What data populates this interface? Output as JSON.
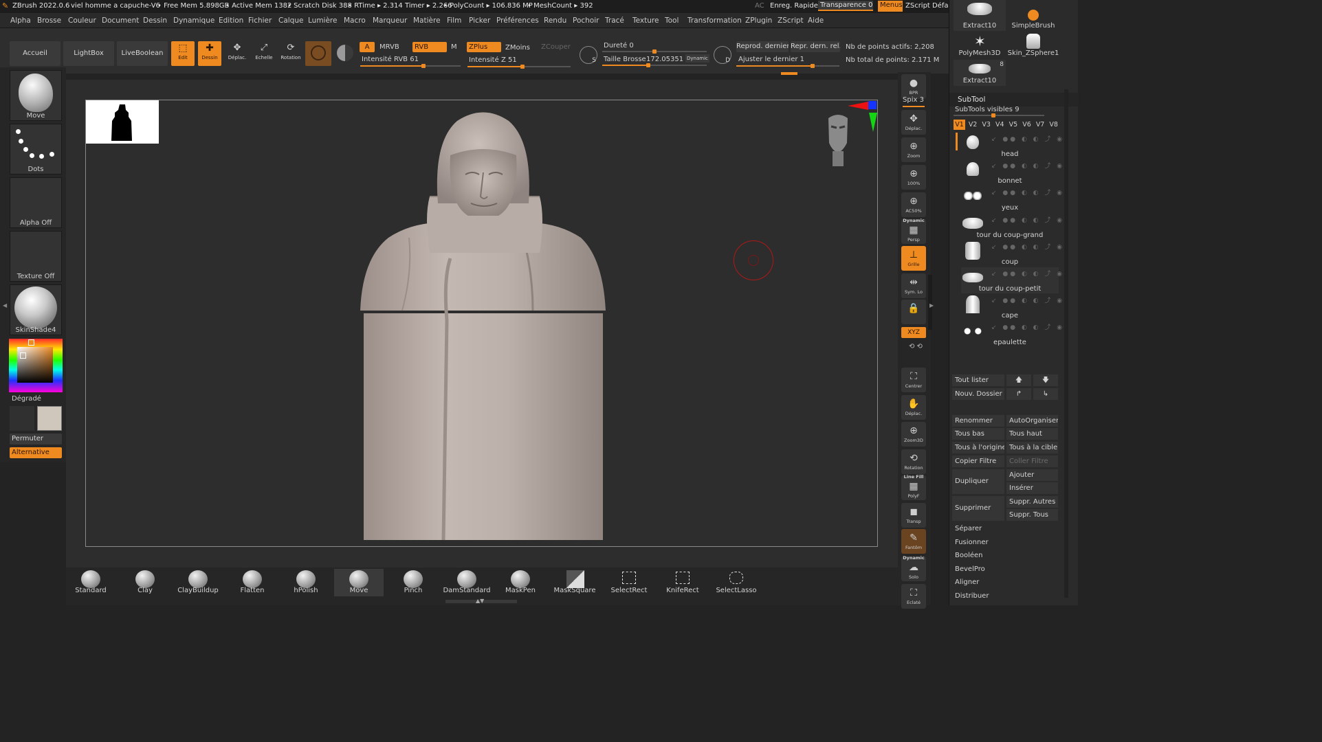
{
  "title_bar": {
    "app": "ZBrush 2022.0.6",
    "project": "viel homme a capuche-V6",
    "free_mem": "• Free Mem 5.898GB",
    "active_mem": "• Active Mem 1382",
    "scratch": "• Scratch Disk 388",
    "rtime": "• RTime ▸ 2.314 Timer ▸ 2.266",
    "polycount": "• PolyCount ▸ 106.836 MP",
    "meshcount": "• MeshCount ▸ 392",
    "ac": "AC",
    "quicksave": "Enreg. Rapide",
    "transparency": "Transparence 0",
    "menus": "Menus",
    "zscript": "ZScript Défaut"
  },
  "menu": [
    "Alpha",
    "Brosse",
    "Couleur",
    "Document",
    "Dessin",
    "Dynamique",
    "Edition",
    "Fichier",
    "Calque",
    "Lumière",
    "Macro",
    "Marqueur",
    "Matière",
    "Film",
    "Picker",
    "Préférences",
    "Rendu",
    "Pochoir",
    "Tracé",
    "Texture",
    "Tool",
    "Transformation",
    "ZPlugin",
    "ZScript",
    "Aide"
  ],
  "shelf": {
    "home": "Accueil",
    "lightbox": "LightBox",
    "liveboolean": "LiveBoolean",
    "edit": "Edit",
    "draw": "Dessin",
    "move": "Déplac.",
    "scale": "Echelle",
    "rotate": "Rotation",
    "a": "A",
    "mrvb": "MRVB",
    "rvb": "RVB",
    "m": "M",
    "intensity_rgb": "Intensité RVB 61",
    "zplus": "ZPlus",
    "zmoins": "ZMoins",
    "zcouper": "ZCouper",
    "intensity_z": "Intensité Z 51",
    "focal_s": "S",
    "hardness": "Dureté 0",
    "brush_size_label": "Taille Brosse",
    "brush_size": "172.05351",
    "dynamic": "Dynamic",
    "focal_d": "D",
    "replay_last": "Reprod. dernier",
    "replay_last_rel": "Repr. dern. rel.",
    "adjust_last": "Ajuster le dernier 1",
    "active_points": "Nb de points actifs: 2,208",
    "total_points": "Nb total de points: 2.171 M"
  },
  "left_tray": {
    "brush": "Move",
    "stroke": "Dots",
    "alpha": "Alpha Off",
    "texture": "Texture Off",
    "material": "SkinShade4",
    "gradient": "Dégradé",
    "swap": "Permuter",
    "alternate": "Alternative"
  },
  "right_tray": [
    {
      "key": "bpr",
      "label": "BPR",
      "icon": "●"
    },
    {
      "key": "spix",
      "label": "Spix 3",
      "icon": ""
    },
    {
      "key": "move",
      "label": "Déplac.",
      "icon": "✥"
    },
    {
      "key": "zoom",
      "label": "Zoom",
      "icon": "⊕"
    },
    {
      "key": "zoom100",
      "label": "100%",
      "icon": "⊕"
    },
    {
      "key": "ac50",
      "label": "AC50%",
      "icon": "⊕"
    },
    {
      "key": "persp",
      "label": "Persp",
      "icon": "▦",
      "top": "Dynamic"
    },
    {
      "key": "floor",
      "label": "Grille",
      "icon": "⊥"
    },
    {
      "key": "sym",
      "label": "Sym. Lo",
      "icon": "⇹"
    },
    {
      "key": "lock",
      "label": "",
      "icon": "🔒"
    },
    {
      "key": "xyz",
      "label": "XYZ",
      "icon": ""
    },
    {
      "key": "frame",
      "label": "Centrer",
      "icon": "⛶"
    },
    {
      "key": "move3d",
      "label": "Déplac.",
      "icon": "✋"
    },
    {
      "key": "zoom3d",
      "label": "Zoom3D",
      "icon": "⊕"
    },
    {
      "key": "rotate3d",
      "label": "Rotation",
      "icon": "⟲"
    },
    {
      "key": "polyf",
      "label": "PolyF",
      "icon": "▦",
      "top": "Line Fill"
    },
    {
      "key": "transp",
      "label": "Transp",
      "icon": "◼"
    },
    {
      "key": "ghost",
      "label": "Fantôm",
      "icon": "✎"
    },
    {
      "key": "solo",
      "label": "Solo",
      "icon": "☁",
      "top": "Dynamic"
    },
    {
      "key": "explode",
      "label": "Eclaté",
      "icon": "⛶"
    }
  ],
  "tool_panel": {
    "thumbs": [
      {
        "name": "Extract10",
        "badge": ""
      },
      {
        "name": "SimpleBrush",
        "badge": ""
      },
      {
        "name": "PolyMesh3D",
        "badge": ""
      },
      {
        "name": "Skin_ZSphere1",
        "badge": ""
      },
      {
        "name": "Extract10",
        "badge": "8"
      }
    ],
    "subtool_title": "SubTool",
    "visible_count": "SubTools visibles 9",
    "versions": [
      "V1",
      "V2",
      "V3",
      "V4",
      "V5",
      "V6",
      "V7",
      "V8"
    ],
    "subtools": [
      "head",
      "bonnet",
      "yeux",
      "tour du coup-grand",
      "coup",
      "tour du coup-petit",
      "cape",
      "epaulette"
    ],
    "list_all": "Tout lister",
    "new_folder": "Nouv. Dossier",
    "rename": "Renommer",
    "autoreorder": "AutoOrganiser",
    "all_low": "Tous bas",
    "all_high": "Tous haut",
    "all_to_origin": "Tous à l'origine",
    "all_to_target": "Tous à la cible",
    "copy_filter": "Copier Filtre",
    "paste_filter": "Coller Filtre",
    "duplicate": "Dupliquer",
    "append": "Ajouter",
    "insert": "Insérer",
    "delete": "Supprimer",
    "del_other": "Suppr. Autres",
    "del_all": "Suppr. Tous",
    "split": "Séparer",
    "merge": "Fusionner",
    "boolean": "Booléen",
    "bevelpro": "BevelPro",
    "align": "Aligner",
    "distribute": "Distribuer"
  },
  "bottom_brushes": [
    "Standard",
    "Clay",
    "ClayBuildup",
    "Flatten",
    "hPolish",
    "Move",
    "Pinch",
    "DamStandard",
    "MaskPen",
    "MaskSquare",
    "SelectRect",
    "KnifeRect",
    "SelectLasso"
  ],
  "colors": {
    "accent": "#ef8a21",
    "bg": "#232323",
    "model": "#b9aca6"
  }
}
